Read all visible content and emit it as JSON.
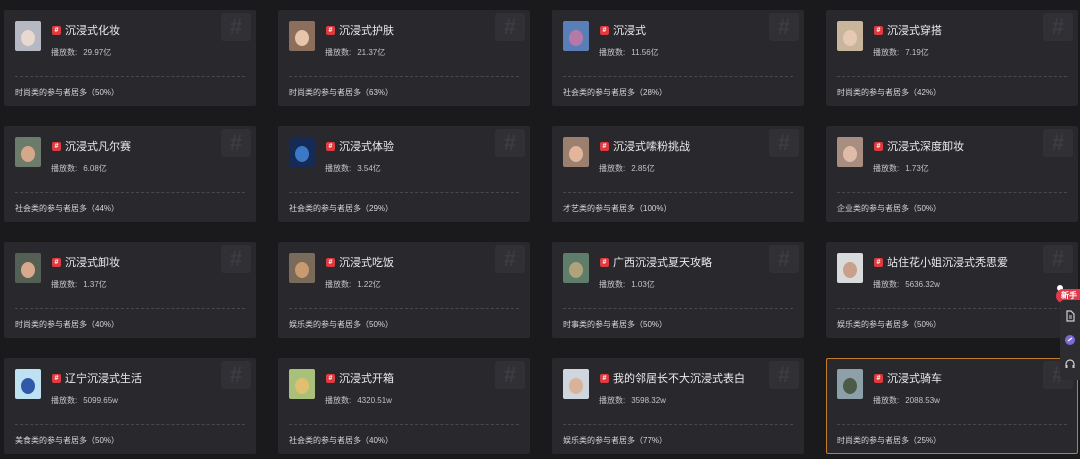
{
  "plays_label": "播放数:",
  "tag_glyph": "#",
  "cards": [
    {
      "title": "沉浸式化妆",
      "plays": "29.97亿",
      "footer": "时尚类的参与者居多（50%）",
      "thumb_bg": "#b7b9c2",
      "thumb_accent": "#e9d8cf"
    },
    {
      "title": "沉浸式护肤",
      "plays": "21.37亿",
      "footer": "时尚类的参与者居多（63%）",
      "thumb_bg": "#8c6e5c",
      "thumb_accent": "#e8c4aa"
    },
    {
      "title": "沉浸式",
      "plays": "11.56亿",
      "footer": "社会类的参与者居多（28%）",
      "thumb_bg": "#5a7fb8",
      "thumb_accent": "#b77aa8"
    },
    {
      "title": "沉浸式穿搭",
      "plays": "7.19亿",
      "footer": "时尚类的参与者居多（42%）",
      "thumb_bg": "#c9b59c",
      "thumb_accent": "#e6c9b4"
    },
    {
      "title": "沉浸式凡尔赛",
      "plays": "6.08亿",
      "footer": "社会类的参与者居多（44%）",
      "thumb_bg": "#6d7b6a",
      "thumb_accent": "#d6a88a"
    },
    {
      "title": "沉浸式体验",
      "plays": "3.54亿",
      "footer": "社会类的参与者居多（29%）",
      "thumb_bg": "#152a55",
      "thumb_accent": "#3a78c8"
    },
    {
      "title": "沉浸式嗦粉挑战",
      "plays": "2.85亿",
      "footer": "才艺类的参与者居多（100%）",
      "thumb_bg": "#9b8070",
      "thumb_accent": "#e3b59a"
    },
    {
      "title": "沉浸式深度卸妆",
      "plays": "1.73亿",
      "footer": "企业类的参与者居多（50%）",
      "thumb_bg": "#a88e80",
      "thumb_accent": "#e0bca8"
    },
    {
      "title": "沉浸式卸妆",
      "plays": "1.37亿",
      "footer": "时尚类的参与者居多（40%）",
      "thumb_bg": "#556055",
      "thumb_accent": "#d9a98d"
    },
    {
      "title": "沉浸式吃饭",
      "plays": "1.22亿",
      "footer": "娱乐类的参与者居多（50%）",
      "thumb_bg": "#7a6a5a",
      "thumb_accent": "#c99a6e"
    },
    {
      "title": "广西沉浸式夏天攻略",
      "plays": "1.03亿",
      "footer": "时事类的参与者居多（50%）",
      "thumb_bg": "#5f7d6b",
      "thumb_accent": "#b0a27a"
    },
    {
      "title": "站住花小姐沉浸式秃思爱",
      "plays": "5636.32w",
      "footer": "娱乐类的参与者居多（50%）",
      "thumb_bg": "#d9dadc",
      "thumb_accent": "#c9a08a"
    },
    {
      "title": "辽宁沉浸式生活",
      "plays": "5099.65w",
      "footer": "美食类的参与者居多（50%）",
      "thumb_bg": "#bfe2f2",
      "thumb_accent": "#2f5aa8"
    },
    {
      "title": "沉浸式开箱",
      "plays": "4320.51w",
      "footer": "社会类的参与者居多（40%）",
      "thumb_bg": "#a9c07a",
      "thumb_accent": "#e0c070"
    },
    {
      "title": "我的邻居长不大沉浸式表白",
      "plays": "3598.32w",
      "footer": "娱乐类的参与者居多（77%）",
      "thumb_bg": "#cfd6de",
      "thumb_accent": "#d8b39a"
    },
    {
      "title": "沉浸式骑车",
      "plays": "2088.53w",
      "footer": "时尚类的参与者居多（25%）",
      "thumb_bg": "#8da0a8",
      "thumb_accent": "#4c5a48"
    }
  ],
  "active_card": 15,
  "side_toolbar": {
    "badge": "新手",
    "icons": [
      "document-icon",
      "link-icon",
      "headset-icon"
    ]
  },
  "colors": {
    "background": "#1a1a1d",
    "card": "#29292d",
    "tag": "#e2393f",
    "active_border": "#c57a2a"
  }
}
